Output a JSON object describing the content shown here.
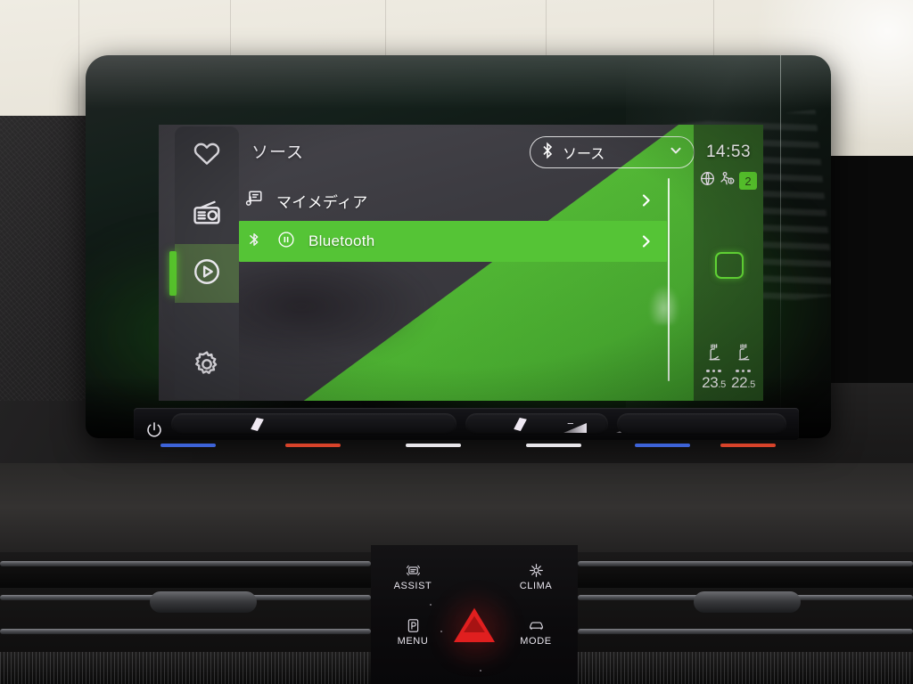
{
  "screen": {
    "header": {
      "title": "ソース",
      "source_dropdown": {
        "label": "ソース",
        "icon": "bluetooth-icon",
        "chevron": "chevron-down-icon"
      }
    },
    "sidebar": {
      "items": [
        {
          "name": "favorites",
          "icon": "heart-icon",
          "active": false
        },
        {
          "name": "radio",
          "icon": "radio-icon",
          "active": false
        },
        {
          "name": "media",
          "icon": "play-circle-icon",
          "active": true
        },
        {
          "name": "settings",
          "icon": "gear-icon",
          "active": false
        }
      ]
    },
    "list": {
      "rows": [
        {
          "label": "マイメディア",
          "icon": "my-media-icon",
          "selected": false,
          "chevron": "chevron-right-icon"
        },
        {
          "label": "Bluetooth",
          "icon": "bluetooth-icon",
          "status_icon": "pause-icon",
          "selected": true,
          "chevron": "chevron-right-icon"
        }
      ]
    },
    "status": {
      "clock": "14:53",
      "icons": [
        "globe-icon",
        "traffic-assist-icon"
      ],
      "gear_badge": "2",
      "square_button": "stop-button",
      "climate": {
        "driver": {
          "seat_icon": "heated-seat-icon",
          "level_dots": 3,
          "temp_int": "23",
          "temp_dec": ".5"
        },
        "passenger": {
          "seat_icon": "heated-seat-icon",
          "level_dots": 3,
          "temp_int": "22",
          "temp_dec": ".5"
        }
      }
    },
    "colors": {
      "accent_green": "#55c436",
      "bright_green": "#5dd32f",
      "panel_gray": "#3a393f",
      "text_white": "#ffffff"
    }
  },
  "hardware": {
    "slider_strip": {
      "power_icon": "power-icon",
      "left_temp_handle": "temperature-handle",
      "right_temp_handle": "temperature-handle",
      "volume_down": "−",
      "volume_up": "+"
    },
    "console": {
      "buttons": [
        {
          "label": "ASSIST",
          "icon": "assist-icon"
        },
        {
          "label": "CLIMA",
          "icon": "clima-icon"
        },
        {
          "label": "MENU",
          "icon": "park-menu-icon"
        },
        {
          "label": "MODE",
          "icon": "drive-mode-icon"
        }
      ],
      "hazard": "hazard-triangle-button"
    }
  }
}
